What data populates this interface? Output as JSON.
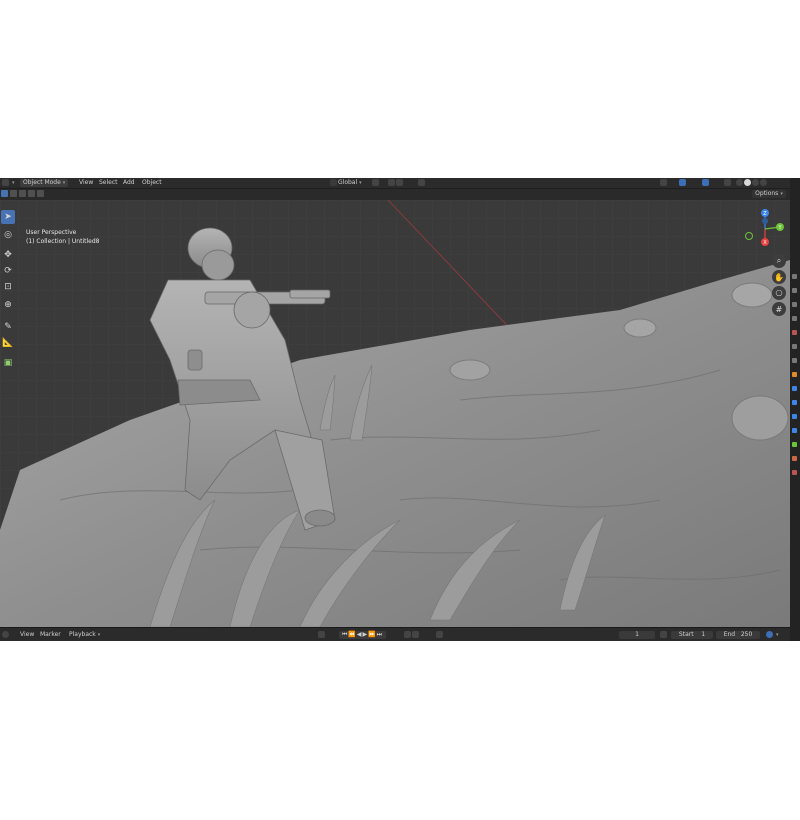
{
  "header": {
    "mode": "Object Mode",
    "menus": [
      "View",
      "Select",
      "Add",
      "Object"
    ],
    "transform_orientation": "Global",
    "options_label": "Options"
  },
  "viewport": {
    "perspective_label": "User Perspective",
    "collection_label": "(1) Collection | Untitled8",
    "gizmo_axes": {
      "x": "X",
      "y": "Y",
      "z": "Z"
    },
    "axis_colors": {
      "x": "#e8413f",
      "y": "#6bc43b",
      "z": "#3d85e6"
    }
  },
  "toolbar": {
    "tools": [
      "select-box",
      "cursor",
      "move",
      "rotate",
      "scale",
      "transform",
      "annotate",
      "measure",
      "add-cube"
    ]
  },
  "timeline": {
    "menus": [
      "View",
      "Marker",
      "Playback"
    ],
    "current_frame": "1",
    "start_label": "Start",
    "start_value": "1",
    "end_label": "End",
    "end_value": "250"
  },
  "colors": {
    "accent": "#4772b3",
    "header_bg": "#2b2b2b",
    "viewport_bg": "#3a3a3a"
  }
}
